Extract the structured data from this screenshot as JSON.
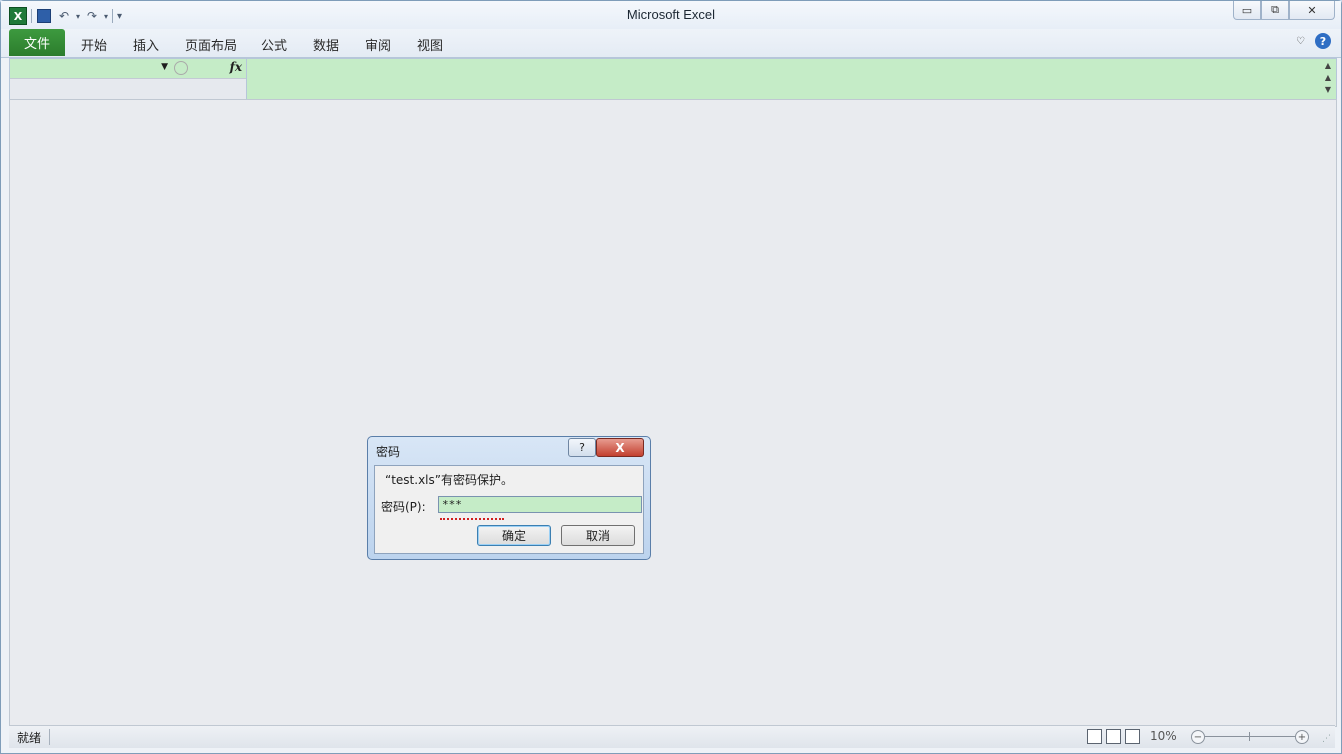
{
  "window": {
    "title": "Microsoft Excel"
  },
  "qat": {
    "app_icon": "excel-icon",
    "items": [
      "save-icon",
      "undo-icon",
      "redo-icon",
      "customize-qat-icon"
    ]
  },
  "ribbon": {
    "file_tab": "文件",
    "tabs": [
      "开始",
      "插入",
      "页面布局",
      "公式",
      "数据",
      "审阅",
      "视图"
    ]
  },
  "formula_bar": {
    "fx_label": "fx"
  },
  "status": {
    "ready": "就绪",
    "zoom": "10%"
  },
  "dialog": {
    "title": "密码",
    "help": "?",
    "close": "X",
    "message": "“test.xls”有密码保护。",
    "password_label": "密码(P):",
    "password_value": "***",
    "ok_label": "确定",
    "cancel_label": "取消"
  },
  "colors": {
    "file_tab": "#2c7d2d",
    "formula_bg": "#c5ecc7",
    "close_btn": "#c3402f"
  }
}
